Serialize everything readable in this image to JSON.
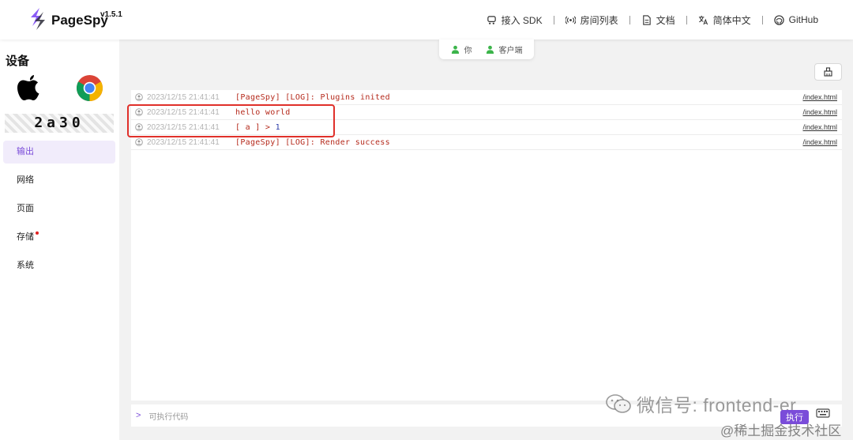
{
  "header": {
    "brand": "PageSpy",
    "version": "v1.5.1",
    "nav": [
      {
        "label": "接入 SDK",
        "icon": "sdk-icon"
      },
      {
        "label": "房间列表",
        "icon": "broadcast-icon"
      },
      {
        "label": "文档",
        "icon": "document-icon"
      },
      {
        "label": "简体中文",
        "icon": "translate-icon"
      },
      {
        "label": "GitHub",
        "icon": "github-icon"
      }
    ]
  },
  "sidebar": {
    "title": "设备",
    "device_os_icon": "apple-icon",
    "device_browser_icon": "chrome-icon",
    "device_id": "2a30",
    "items": [
      {
        "label": "输出",
        "active": true
      },
      {
        "label": "网络"
      },
      {
        "label": "页面"
      },
      {
        "label": "存储",
        "badge": "red-dot"
      },
      {
        "label": "系统"
      }
    ]
  },
  "segment": {
    "you": "你",
    "client": "客户端"
  },
  "console": {
    "logs": [
      {
        "time": "2023/12/15 21:41:41",
        "message": "[PageSpy] [LOG]: Plugins inited",
        "source": "/index.html"
      },
      {
        "time": "2023/12/15 21:41:41",
        "message": "hello world",
        "source": "/index.html"
      },
      {
        "time": "2023/12/15 21:41:41",
        "message_prefix": "[ a ] > ",
        "message_value": "1",
        "source": "/index.html"
      },
      {
        "time": "2023/12/15 21:41:41",
        "message": "[PageSpy] [LOG]: Render success",
        "source": "/index.html"
      }
    ],
    "input_placeholder": "可执行代码",
    "prompt": ">",
    "exec_label": "执行"
  },
  "watermark": {
    "line1": "微信号: frontend-er",
    "line2": "@稀土掘金技术社区"
  },
  "colors": {
    "accent": "#7a4cd9",
    "log_red": "#b52a1c",
    "highlight": "#e0302a",
    "online_green": "#3bb44a"
  }
}
